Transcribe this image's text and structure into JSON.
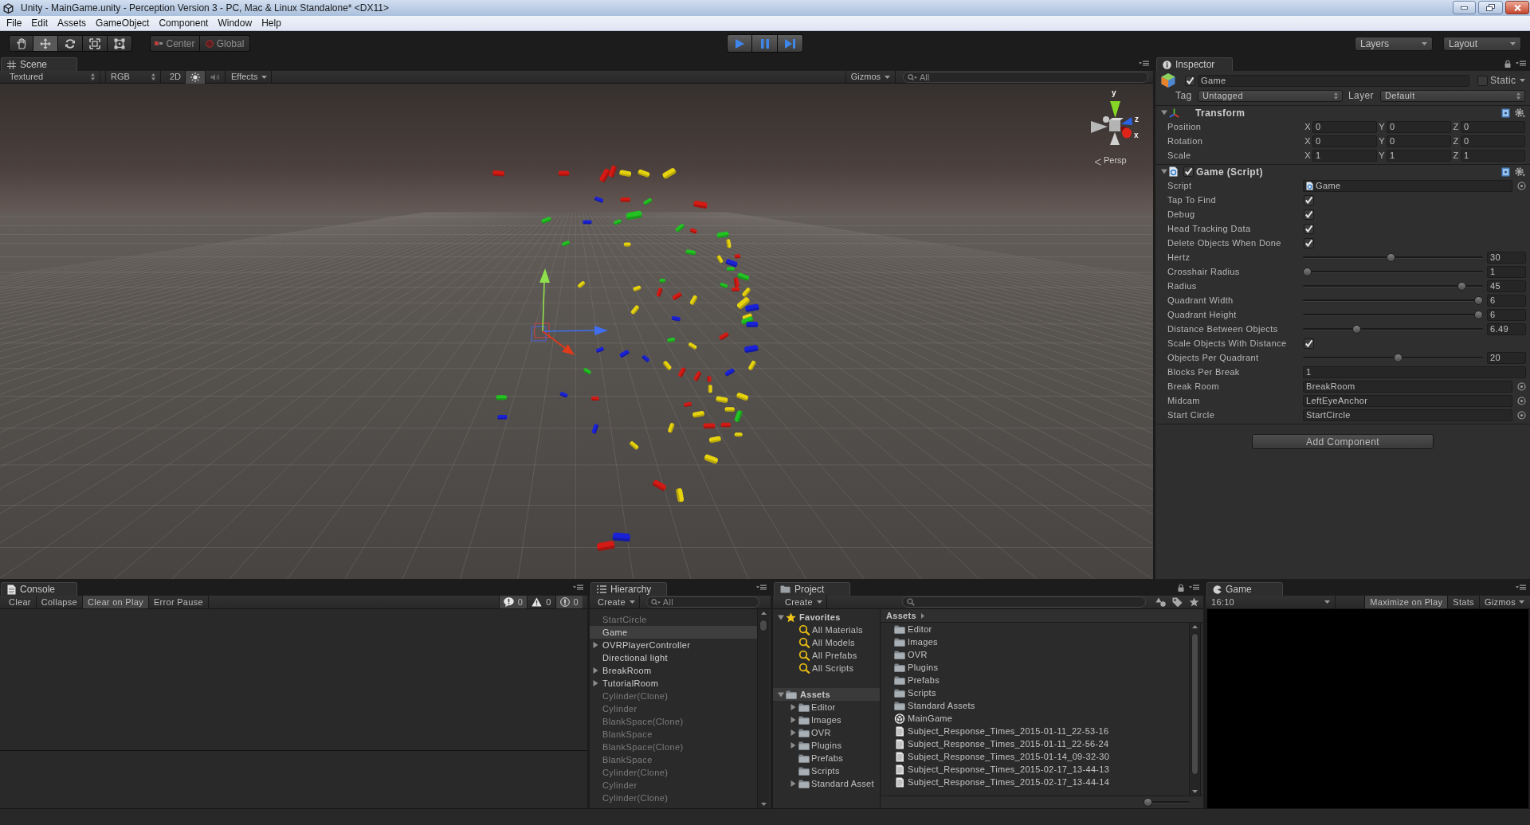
{
  "window": {
    "title": "Unity - MainGame.unity - Perception Version 3 - PC, Mac & Linux Standalone* <DX11>"
  },
  "menu": [
    "File",
    "Edit",
    "Assets",
    "GameObject",
    "Component",
    "Window",
    "Help"
  ],
  "toolbar": {
    "tools": [
      {
        "kind": "hand",
        "selected": false
      },
      {
        "kind": "move",
        "selected": true
      },
      {
        "kind": "rotate",
        "selected": false
      },
      {
        "kind": "scale",
        "selected": false
      },
      {
        "kind": "rect",
        "selected": false
      }
    ],
    "pivot": [
      {
        "kind": "pivot",
        "label": "Center"
      },
      {
        "kind": "space",
        "label": "Global"
      }
    ],
    "playback": [
      {
        "kind": "play"
      },
      {
        "kind": "pause"
      },
      {
        "kind": "step"
      }
    ],
    "dropdowns": [
      "Layers",
      "Layout"
    ]
  },
  "scene": {
    "tab": "Scene",
    "draw_mode": "Textured",
    "render_mode": "RGB",
    "toggles": [
      {
        "kind": "dimension",
        "label": "2D",
        "on": false
      },
      {
        "kind": "lighting",
        "on": true
      },
      {
        "kind": "audio",
        "on": false
      }
    ],
    "effects": "Effects",
    "gizmos": "Gizmos",
    "search": {
      "placeholder": "All"
    },
    "gizmo_axes": [
      {
        "axis": "y"
      },
      {
        "axis": "z"
      },
      {
        "axis": "x"
      }
    ],
    "projection": "Persp"
  },
  "inspector": {
    "tab": "Inspector",
    "object": {
      "active": true,
      "name": "Game",
      "static": false,
      "static_label": "Static",
      "tag_label": "Tag",
      "tag": "Untagged",
      "layer_label": "Layer",
      "layer": "Default"
    },
    "components": [
      {
        "kind": "transform",
        "title": "Transform",
        "expanded": true,
        "rows": [
          {
            "label": "Position",
            "values": [
              {
                "axis": "X",
                "value": "0"
              },
              {
                "axis": "Y",
                "value": "0"
              },
              {
                "axis": "Z",
                "value": "0"
              }
            ]
          },
          {
            "label": "Rotation",
            "values": [
              {
                "axis": "X",
                "value": "0"
              },
              {
                "axis": "Y",
                "value": "0"
              },
              {
                "axis": "Z",
                "value": "0"
              }
            ]
          },
          {
            "label": "Scale",
            "values": [
              {
                "axis": "X",
                "value": "1"
              },
              {
                "axis": "Y",
                "value": "1"
              },
              {
                "axis": "Z",
                "value": "1"
              }
            ]
          }
        ]
      },
      {
        "kind": "script",
        "title": "Game (Script)",
        "expanded": true,
        "enabled": true,
        "properties": [
          {
            "kind": "script",
            "label": "Script",
            "value": "Game"
          },
          {
            "kind": "checkbox",
            "label": "Tap To Find",
            "checked": true
          },
          {
            "kind": "checkbox",
            "label": "Debug",
            "checked": true
          },
          {
            "kind": "checkbox",
            "label": "Head Tracking Data",
            "checked": true
          },
          {
            "kind": "checkbox",
            "label": "Delete Objects When Done",
            "checked": true
          },
          {
            "kind": "slider",
            "label": "Hertz",
            "level": 0.49,
            "value": "30"
          },
          {
            "kind": "slider",
            "label": "Crosshair Radius",
            "level": 0,
            "value": "1"
          },
          {
            "kind": "slider",
            "label": "Radius",
            "level": 0.9,
            "value": "45"
          },
          {
            "kind": "slider",
            "label": "Quadrant Width",
            "level": 1,
            "value": "6"
          },
          {
            "kind": "slider",
            "label": "Quadrant Height",
            "level": 1,
            "value": "6"
          },
          {
            "kind": "slider",
            "label": "Distance Between Objects",
            "level": 0.29,
            "value": "6.49"
          },
          {
            "kind": "checkbox",
            "label": "Scale Objects With Distance",
            "checked": true
          },
          {
            "kind": "slider",
            "label": "Objects Per Quadrant",
            "level": 0.53,
            "value": "20"
          },
          {
            "kind": "int",
            "label": "Blocks Per Break",
            "value": "1"
          },
          {
            "kind": "object",
            "label": "Break Room",
            "value": "BreakRoom"
          },
          {
            "kind": "object",
            "label": "Midcam",
            "value": "LeftEyeAnchor"
          },
          {
            "kind": "object",
            "label": "Start Circle",
            "value": "StartCircle"
          }
        ]
      }
    ],
    "add_component": "Add Component"
  },
  "console": {
    "tab": "Console",
    "buttons": [
      {
        "label": "Clear",
        "on": false
      },
      {
        "label": "Collapse",
        "on": false
      },
      {
        "label": "Clear on Play",
        "on": true
      },
      {
        "label": "Error Pause",
        "on": false
      }
    ],
    "counters": [
      {
        "kind": "info",
        "count": "0",
        "on": true
      },
      {
        "kind": "warning",
        "count": "0",
        "on": false
      },
      {
        "kind": "error",
        "count": "0",
        "on": true
      }
    ]
  },
  "hierarchy": {
    "tab": "Hierarchy",
    "create": "Create",
    "search": {
      "placeholder": "All"
    },
    "items": [
      {
        "name": "StartCircle",
        "has_children": false,
        "active": false,
        "selected": false
      },
      {
        "name": "Game",
        "has_children": false,
        "active": true,
        "selected": true
      },
      {
        "name": "OVRPlayerController",
        "has_children": true,
        "active": true,
        "selected": false
      },
      {
        "name": "Directional light",
        "has_children": false,
        "active": true,
        "selected": false
      },
      {
        "name": "BreakRoom",
        "has_children": true,
        "active": true,
        "selected": false
      },
      {
        "name": "TutorialRoom",
        "has_children": true,
        "active": true,
        "selected": false
      },
      {
        "name": "Cylinder(Clone)",
        "has_children": false,
        "active": false,
        "selected": false
      },
      {
        "name": "Cylinder",
        "has_children": false,
        "active": false,
        "selected": false
      },
      {
        "name": "BlankSpace(Clone)",
        "has_children": false,
        "active": false,
        "selected": false
      },
      {
        "name": "BlankSpace",
        "has_children": false,
        "active": false,
        "selected": false
      },
      {
        "name": "BlankSpace(Clone)",
        "has_children": false,
        "active": false,
        "selected": false
      },
      {
        "name": "BlankSpace",
        "has_children": false,
        "active": false,
        "selected": false
      },
      {
        "name": "Cylinder(Clone)",
        "has_children": false,
        "active": false,
        "selected": false
      },
      {
        "name": "Cylinder",
        "has_children": false,
        "active": false,
        "selected": false
      },
      {
        "name": "Cylinder(Clone)",
        "has_children": false,
        "active": false,
        "selected": false
      }
    ]
  },
  "project": {
    "tab": "Project",
    "create": "Create",
    "tree": [
      {
        "name": "Favorites",
        "kind": "favorites",
        "expanded": true,
        "selected": false,
        "children": [
          {
            "name": "All Materials",
            "kind": "search",
            "has_children": false,
            "selected": false
          },
          {
            "name": "All Models",
            "kind": "search",
            "has_children": false,
            "selected": false
          },
          {
            "name": "All Prefabs",
            "kind": "search",
            "has_children": false,
            "selected": false
          },
          {
            "name": "All Scripts",
            "kind": "search",
            "has_children": false,
            "selected": false
          }
        ]
      },
      {
        "name": "Assets",
        "kind": "folder",
        "expanded": true,
        "selected": true,
        "children": [
          {
            "name": "Editor",
            "kind": "folder",
            "has_children": true,
            "selected": false
          },
          {
            "name": "Images",
            "kind": "folder",
            "has_children": true,
            "selected": false
          },
          {
            "name": "OVR",
            "kind": "folder",
            "has_children": true,
            "selected": false
          },
          {
            "name": "Plugins",
            "kind": "folder",
            "has_children": true,
            "selected": false
          },
          {
            "name": "Prefabs",
            "kind": "folder",
            "has_children": false,
            "selected": false
          },
          {
            "name": "Scripts",
            "kind": "folder",
            "has_children": false,
            "selected": false
          },
          {
            "name": "Standard Asset",
            "kind": "folder",
            "has_children": true,
            "selected": false
          }
        ]
      }
    ],
    "breadcrumb": "Assets",
    "items": [
      {
        "name": "Editor",
        "kind": "folder",
        "selected": false
      },
      {
        "name": "Images",
        "kind": "folder",
        "selected": false
      },
      {
        "name": "OVR",
        "kind": "folder",
        "selected": false
      },
      {
        "name": "Plugins",
        "kind": "folder",
        "selected": false
      },
      {
        "name": "Prefabs",
        "kind": "folder",
        "selected": false
      },
      {
        "name": "Scripts",
        "kind": "folder",
        "selected": false
      },
      {
        "name": "Standard Assets",
        "kind": "folder",
        "selected": false
      },
      {
        "name": "MainGame",
        "kind": "scene",
        "selected": false
      },
      {
        "name": "Subject_Response_Times_2015-01-11_22-53-16",
        "kind": "text",
        "selected": false
      },
      {
        "name": "Subject_Response_Times_2015-01-11_22-56-24",
        "kind": "text",
        "selected": false
      },
      {
        "name": "Subject_Response_Times_2015-01-14_09-32-30",
        "kind": "text",
        "selected": false
      },
      {
        "name": "Subject_Response_Times_2015-02-17_13-44-13",
        "kind": "text",
        "selected": false
      },
      {
        "name": "Subject_Response_Times_2015-02-17_13-44-14",
        "kind": "text",
        "selected": false
      }
    ],
    "icon_size": {
      "level": 0
    }
  },
  "game": {
    "tab": "Game",
    "aspect": "16:10",
    "buttons": [
      {
        "label": "Maximize on Play",
        "on": true
      },
      {
        "label": "Stats",
        "on": false
      }
    ],
    "gizmos": "Gizmos"
  }
}
